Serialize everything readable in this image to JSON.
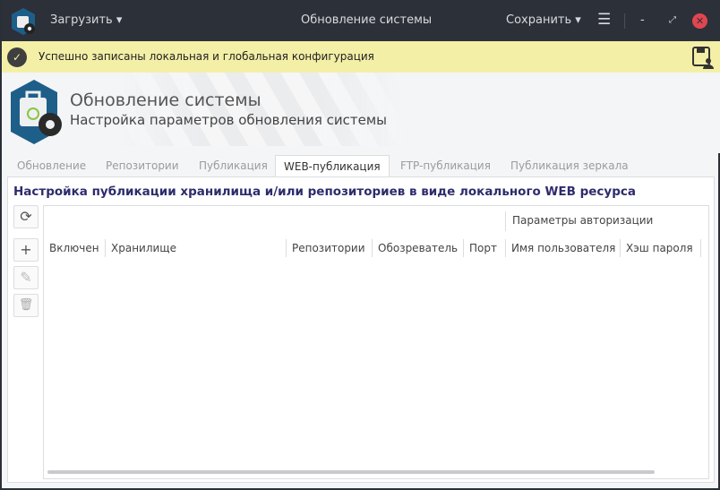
{
  "titlebar": {
    "load_label": "Загрузить",
    "title": "Обновление системы",
    "save_label": "Сохранить"
  },
  "notification": {
    "text": "Успешно записаны локальная и глобальная конфигурация"
  },
  "header": {
    "title": "Обновление системы",
    "subtitle": "Настройка параметров обновления системы"
  },
  "tabs": [
    {
      "label": "Обновление"
    },
    {
      "label": "Репозитории"
    },
    {
      "label": "Публикация"
    },
    {
      "label": "WEB-публикация",
      "active": true
    },
    {
      "label": "FTP-публикация"
    },
    {
      "label": "Публикация зеркала"
    }
  ],
  "section": {
    "heading": "Настройка публикации хранилища и/или репозиториев в виде локального WEB ресурса"
  },
  "table": {
    "group_header": "Параметры авторизации",
    "columns": [
      "Включен",
      "Хранилище",
      "Репозитории",
      "Обозреватель",
      "Порт",
      "Имя пользователя",
      "Хэш пароля"
    ],
    "rows": []
  },
  "colors": {
    "titlebar": "#2c3039",
    "notification": "#f4efa6",
    "heading": "#2e2b6c",
    "close": "#e0464f"
  }
}
